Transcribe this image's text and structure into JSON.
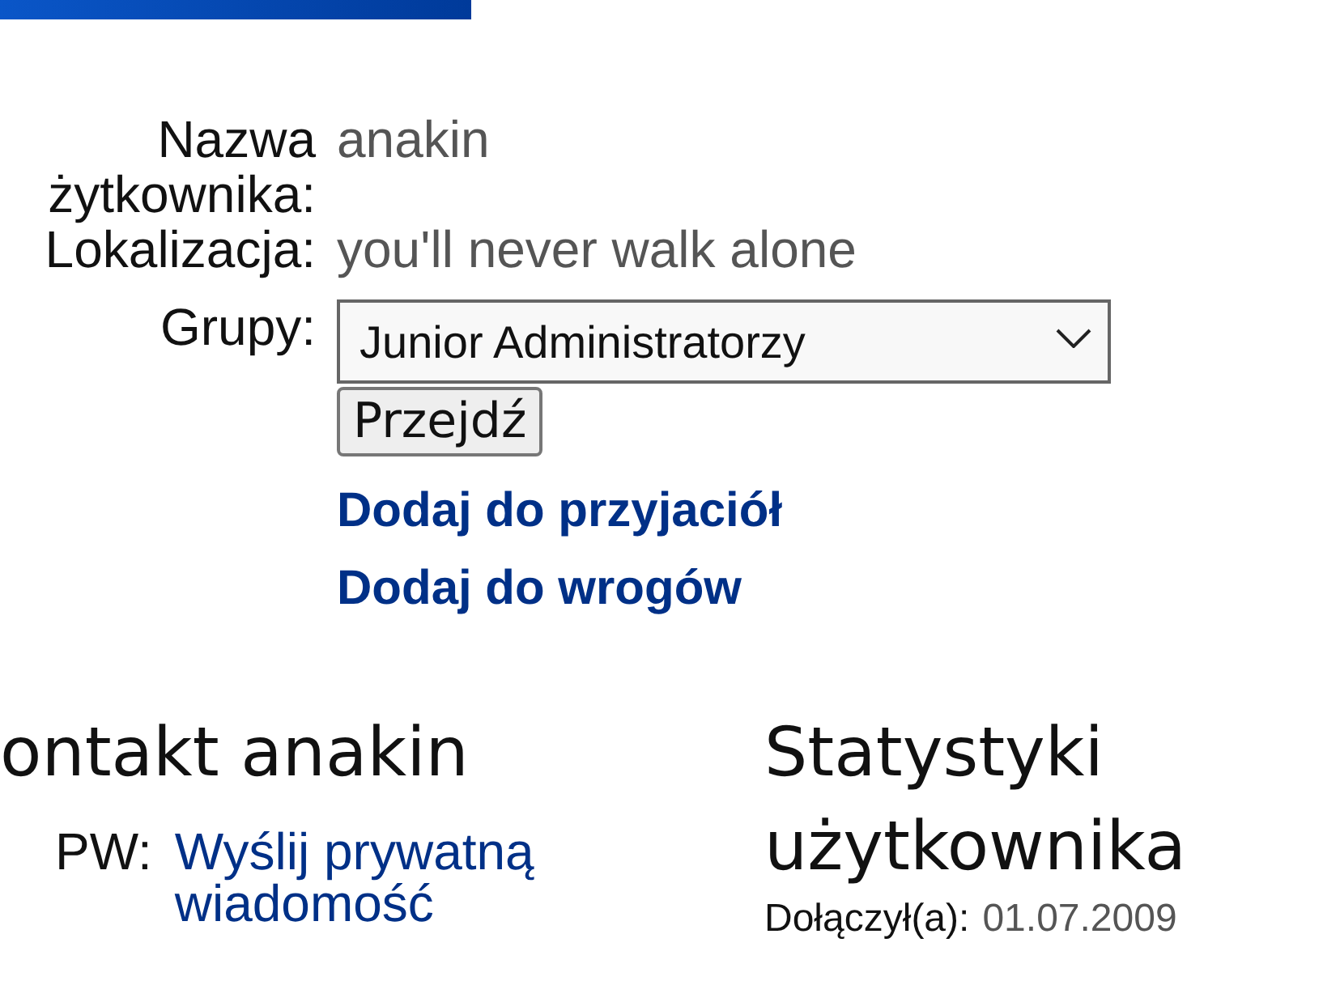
{
  "profile": {
    "fields": [
      {
        "label": "Nazwa żytkownika:",
        "value": "anakin"
      },
      {
        "label": "Lokalizacja:",
        "value": "you'll never walk alone"
      }
    ],
    "groups": {
      "label": "Grupy:",
      "value": "Junior Administratorzy",
      "button": "Przejdź"
    },
    "links": [
      "Dodaj do przyjaciół",
      "Dodaj do wrogów"
    ]
  },
  "contact": {
    "heading": "ontakt anakin",
    "rows": [
      {
        "label": "PW:",
        "link": "Wyślij prywatną wiadomość"
      }
    ]
  },
  "stats": {
    "heading": "Statystyki użytkownika",
    "rows": [
      {
        "label": "Dołączył(a):",
        "value": "01.07.2009"
      }
    ]
  }
}
